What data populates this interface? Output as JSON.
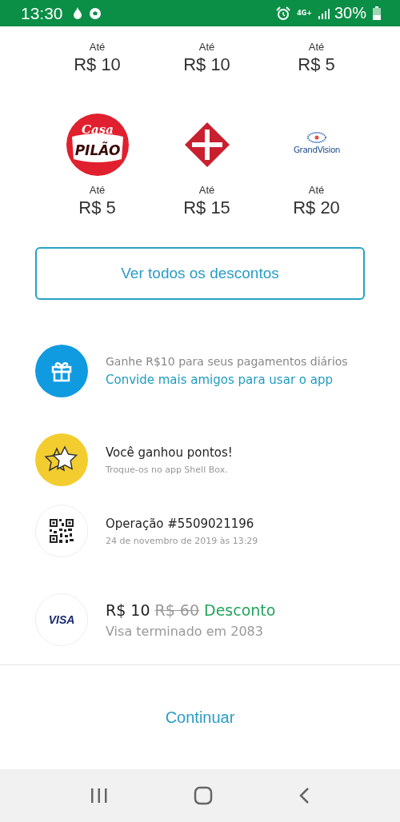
{
  "status_bar": {
    "time": "13:30",
    "battery": "30%",
    "network": "4G+"
  },
  "discount_rows": [
    {
      "merchants": [
        {
          "kind": "none",
          "prefix": "Até",
          "amount": "R$ 10"
        },
        {
          "kind": "none",
          "prefix": "Até",
          "amount": "R$ 10"
        },
        {
          "kind": "none",
          "prefix": "Até",
          "amount": "R$ 5"
        }
      ]
    },
    {
      "merchants": [
        {
          "kind": "round",
          "logo_text": [
            "Casa",
            "PILÃO"
          ],
          "prefix": "Até",
          "amount": "R$ 5"
        },
        {
          "kind": "diamond",
          "prefix": "Até",
          "amount": "R$ 15"
        },
        {
          "kind": "wordmark",
          "logo_text": [
            "GrandVision"
          ],
          "prefix": "Até",
          "amount": "R$ 20"
        }
      ]
    }
  ],
  "all_discounts_button": "Ver todos os descontos",
  "items": [
    {
      "kind": "gift",
      "title": "Ganhe R$10 para seus pagamentos diários",
      "link": "Convide mais amigos para usar o app"
    },
    {
      "kind": "star",
      "title": "Você ganhou pontos!",
      "subtitle": "Troque-os no app Shell Box."
    },
    {
      "kind": "qr",
      "title": "Operação #5509021196",
      "subtitle": "24 de novembro de 2019 às 13:29"
    },
    {
      "kind": "card",
      "logo_text": "VISA",
      "price": "R$ 10",
      "old_price": "R$ 60",
      "discount": "Desconto",
      "subtitle": "Visa terminado em 2083"
    }
  ],
  "continue_button": "Continuar"
}
